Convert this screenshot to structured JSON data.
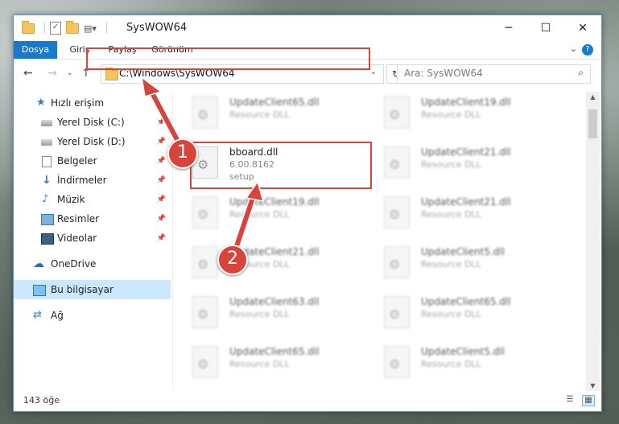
{
  "window": {
    "title": "SysWOW64"
  },
  "ribbon": {
    "tabs": [
      "Dosya",
      "Giriş",
      "Paylaş",
      "Görünüm"
    ],
    "help": "?"
  },
  "address": {
    "path": "C:\\Windows\\SysWOW64",
    "search_placeholder": "Ara: SysWOW64"
  },
  "sidebar": {
    "quick_access": "Hızlı erişim",
    "items": [
      "Yerel Disk (C:)",
      "Yerel Disk (D:)",
      "Belgeler",
      "İndirmeler",
      "Müzik",
      "Resimler",
      "Videolar"
    ],
    "onedrive": "OneDrive",
    "this_pc": "Bu bilgisayar",
    "network": "Ağ"
  },
  "files": {
    "col1": [
      {
        "name": "UpdateClient65.dll",
        "type": "Resource DLL"
      },
      {
        "name": "bboard.dll",
        "version": "6.00.8162",
        "desc": "setup"
      },
      {
        "name": "UpdateClient19.dll",
        "type": "Resource DLL"
      },
      {
        "name": "UpdateClient21.dll",
        "type": "Resource DLL"
      },
      {
        "name": "UpdateClient63.dll",
        "type": "Resource DLL"
      },
      {
        "name": "UpdateClient65.dll",
        "type": "Resource DLL"
      }
    ],
    "col2": [
      {
        "name": "UpdateClient19.dll",
        "type": "Resource DLL"
      },
      {
        "name": "UpdateClient21.dll",
        "type": "Resource DLL"
      },
      {
        "name": "UpdateClient21.dll",
        "type": "Resource DLL"
      },
      {
        "name": "UpdateClient5.dll",
        "type": "Resource DLL"
      },
      {
        "name": "UpdateClient65.dll",
        "type": "Resource DLL"
      },
      {
        "name": "UpdateClient5.dll",
        "type": "Resource DLL"
      }
    ]
  },
  "status": {
    "count": "143 öğe"
  },
  "annotations": {
    "step1": "1",
    "step2": "2",
    "color": "#d7443b"
  }
}
